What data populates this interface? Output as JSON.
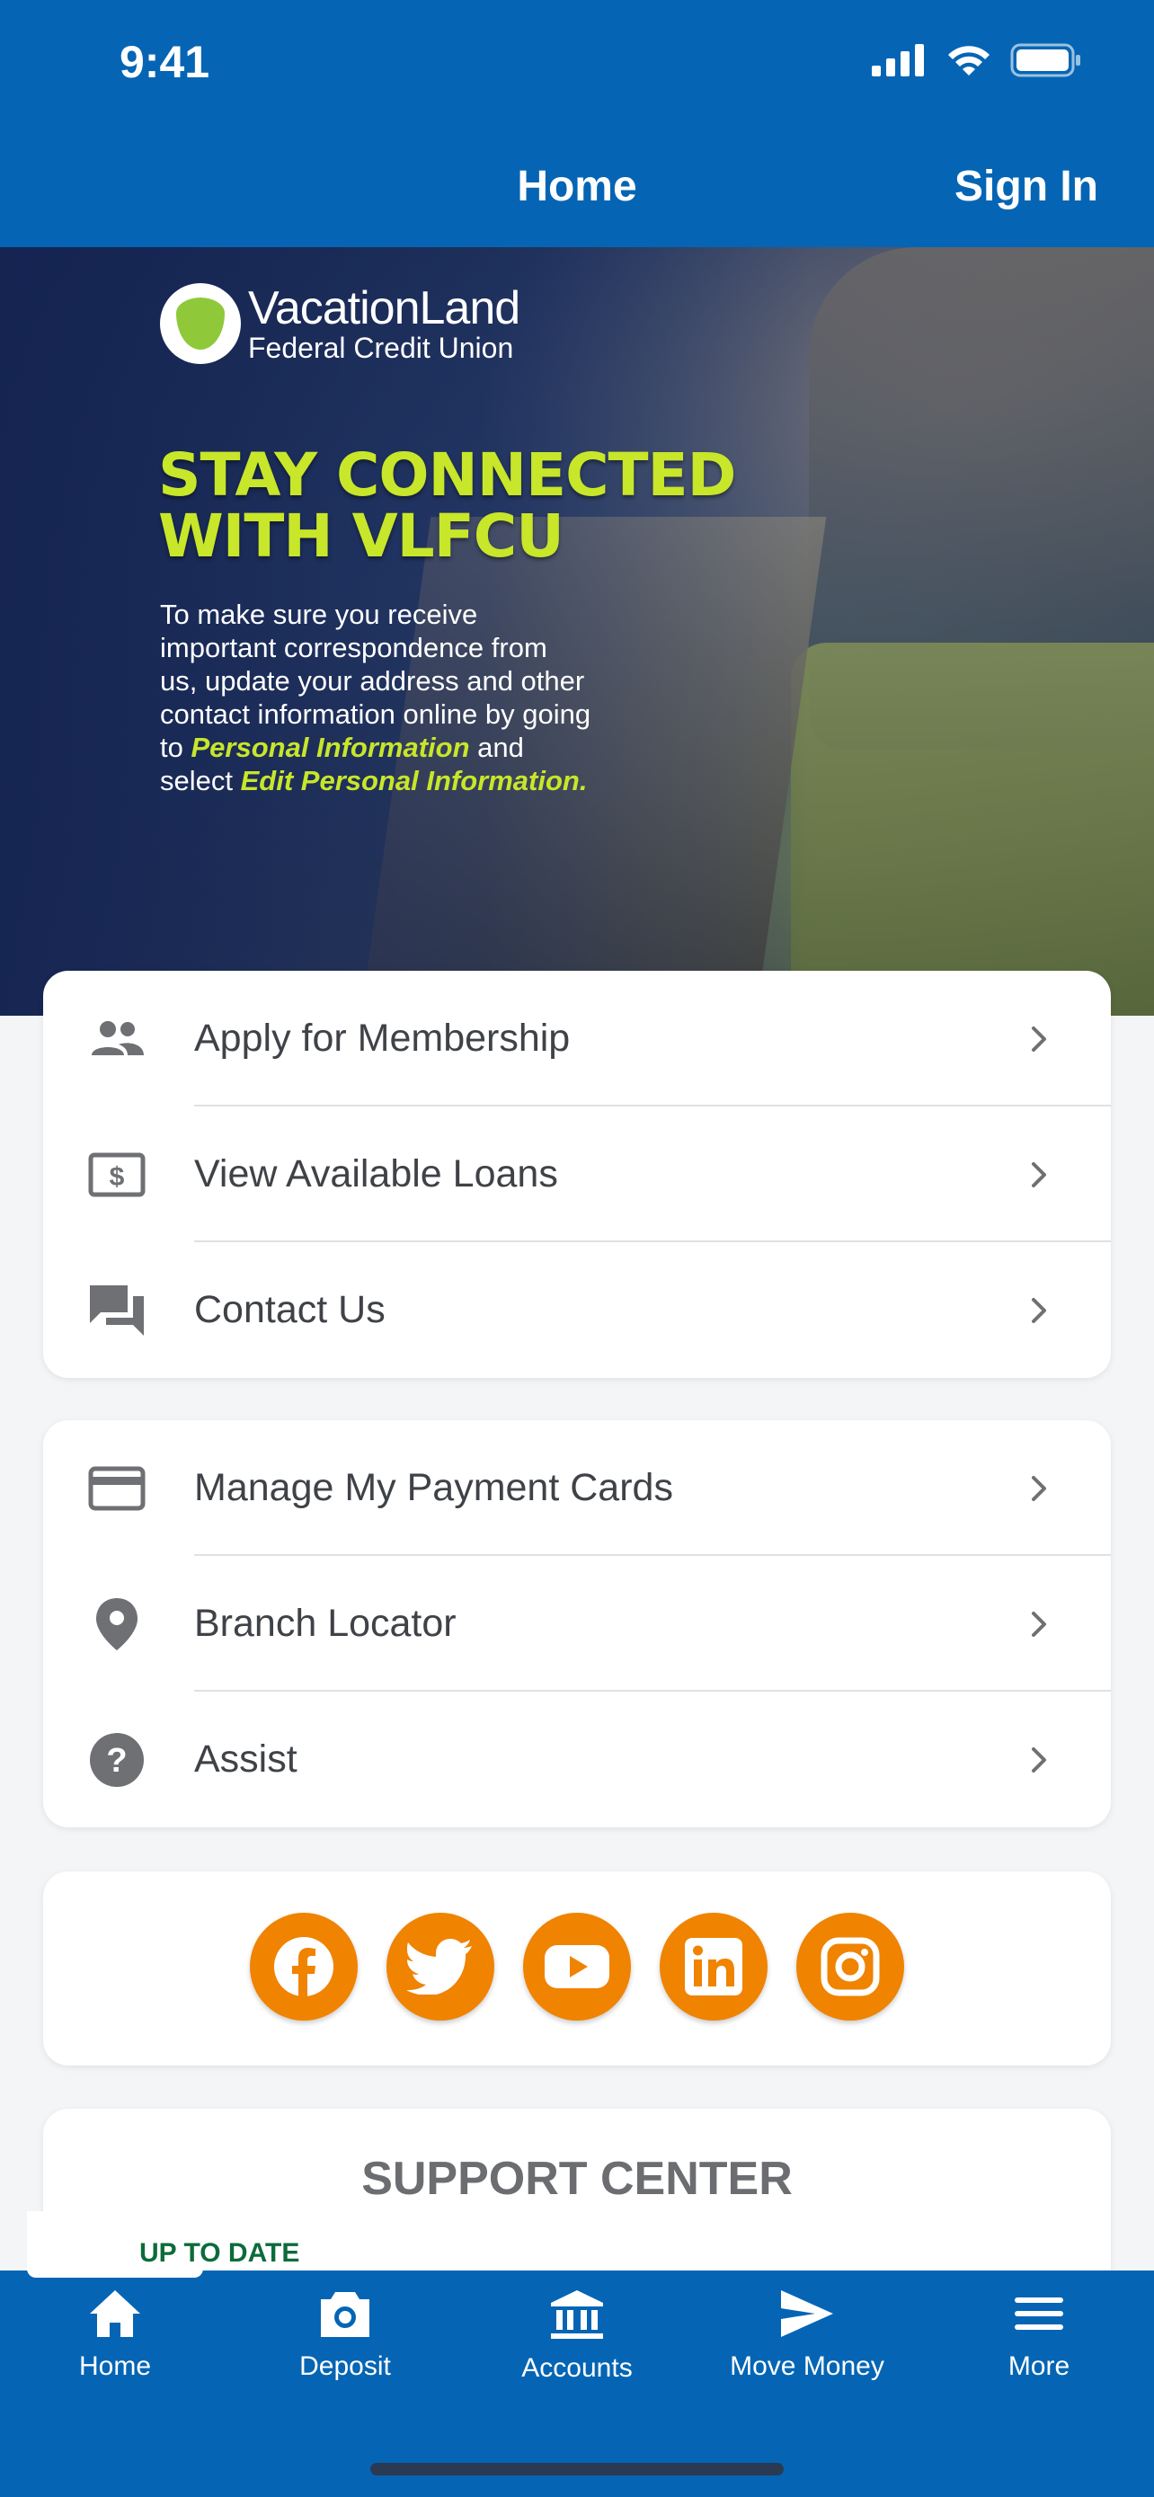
{
  "status": {
    "time": "9:41"
  },
  "nav": {
    "title": "Home",
    "sign_in": "Sign In"
  },
  "hero": {
    "logo_line1": "VacationLand",
    "logo_line2": "Federal Credit Union",
    "headline_line1": "STAY CONNECTED",
    "headline_line2": "WITH VLFCU",
    "body_lead": "To make sure you receive important correspondence from us, update your address and other contact information online by going to",
    "body_link1": "Personal Information",
    "body_mid": "and select",
    "body_link2": "Edit Personal Information.",
    "accent_color": "#c8e62a"
  },
  "menu_group_1": [
    {
      "label": "Apply for Membership",
      "icon": "people-icon"
    },
    {
      "label": "View Available Loans",
      "icon": "dollar-bill-icon"
    },
    {
      "label": "Contact Us",
      "icon": "chat-bubbles-icon"
    }
  ],
  "menu_group_2": [
    {
      "label": "Manage My Payment Cards",
      "icon": "credit-card-icon"
    },
    {
      "label": "Branch Locator",
      "icon": "map-pin-icon"
    },
    {
      "label": "Assist",
      "icon": "help-circle-icon"
    }
  ],
  "social": [
    "facebook-icon",
    "twitter-icon",
    "youtube-icon",
    "linkedin-icon",
    "instagram-icon"
  ],
  "support": {
    "title": "SUPPORT CENTER",
    "badge": "UP TO DATE"
  },
  "tabs": [
    {
      "label": "Home",
      "icon": "home-icon"
    },
    {
      "label": "Deposit",
      "icon": "camera-icon"
    },
    {
      "label": "Accounts",
      "icon": "bank-icon"
    },
    {
      "label": "Move Money",
      "icon": "send-icon"
    },
    {
      "label": "More",
      "icon": "menu-icon"
    }
  ],
  "colors": {
    "brand_blue": "#0565b4",
    "social_orange": "#f08300",
    "icon_gray": "#6f7073"
  }
}
